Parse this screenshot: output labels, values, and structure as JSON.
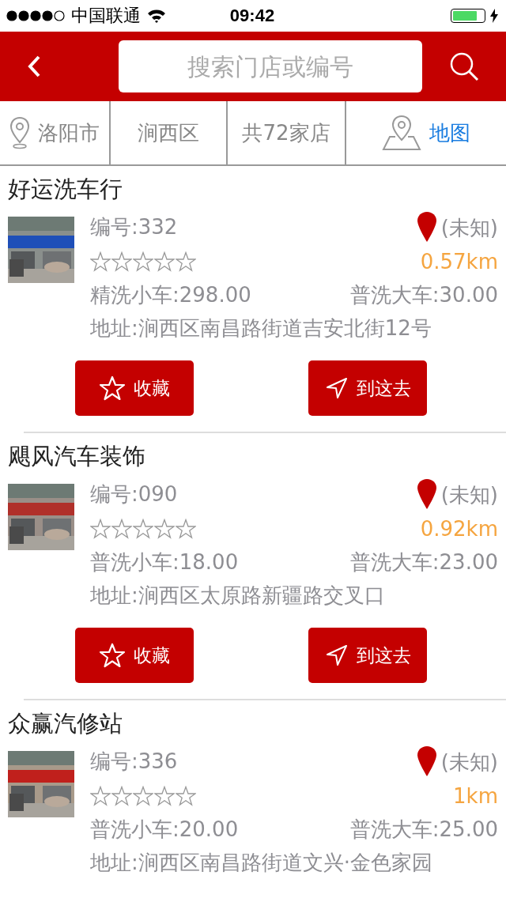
{
  "status_bar": {
    "carrier": "中国联通",
    "time": "09:42"
  },
  "header": {
    "search": {
      "placeholder": "搜索门店或编号"
    }
  },
  "filters": [
    {
      "kind": "city",
      "label": "洛阳市"
    },
    {
      "kind": "plain",
      "label": "涧西区"
    },
    {
      "kind": "plain",
      "label": "共72家店"
    },
    {
      "kind": "map",
      "label": "地图"
    }
  ],
  "stores": [
    {
      "name": "好运洗车行",
      "number": "编号:332",
      "location": "(未知)",
      "distance": "0.57km",
      "stars": 0,
      "price_1": "精洗小车:298.00",
      "price_2": "普洗大车:30.00",
      "address": "地址:涧西区南昌路街道吉安北街12号",
      "actions": [
        {
          "kind": "favorite",
          "label": "收藏"
        },
        {
          "kind": "navigate",
          "label": "到这去"
        }
      ]
    },
    {
      "name": "飓风汽车装饰",
      "number": "编号:090",
      "location": "(未知)",
      "distance": "0.92km",
      "stars": 0,
      "price_1": "普洗小车:18.00",
      "price_2": "普洗大车:23.00",
      "address": "地址:涧西区太原路新疆路交叉口",
      "actions": [
        {
          "kind": "favorite",
          "label": "收藏"
        },
        {
          "kind": "navigate",
          "label": "到这去"
        }
      ]
    },
    {
      "name": "众赢汽修站",
      "number": "编号:336",
      "location": "(未知)",
      "distance": "1km",
      "stars": 0,
      "price_1": "普洗小车:20.00",
      "price_2": "普洗大车:25.00",
      "address": "地址:涧西区南昌路街道文兴·金色家园"
    }
  ]
}
